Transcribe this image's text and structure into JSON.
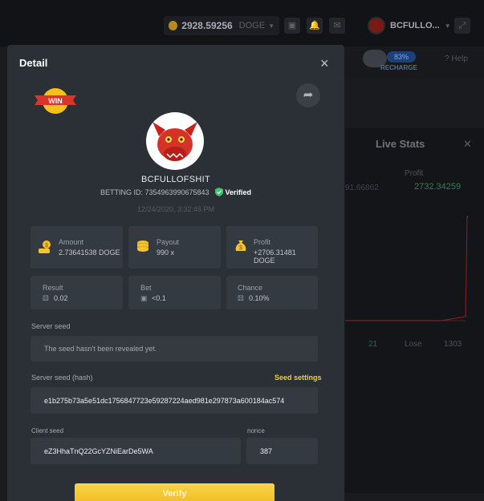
{
  "topbar": {
    "balance": "2928.59256",
    "currency": "DOGE",
    "username": "BCFULLO...",
    "recharge": "RECHARGE",
    "percent": "83%",
    "help": "Help"
  },
  "livestats": {
    "title": "Live Stats",
    "profit_label": "Profit",
    "profit_value": "2732.34259",
    "partial_value": "91.66862",
    "lose_label": "Lose",
    "count_a": "21",
    "count_b": "1303"
  },
  "modal": {
    "title": "Detail",
    "close": "×",
    "win_label": "WIN",
    "username": "BCFULLOFSHIT",
    "betting_id": "BETTING ID: 7354963990675843",
    "verified": "Verified",
    "date": "12/24/2020, 3:32:46 PM",
    "stats": [
      {
        "label": "Amount",
        "value": "2.73641538 DOGE"
      },
      {
        "label": "Payout",
        "value": "990 x"
      },
      {
        "label": "Profit",
        "value": "+2706.31481 DOGE"
      },
      {
        "label": "Result",
        "value": "0.02"
      },
      {
        "label": "Bet",
        "value": "<0.1"
      },
      {
        "label": "Chance",
        "value": "0.10%"
      }
    ],
    "server_seed_label": "Server seed",
    "server_seed_value": "The seed hasn't been revealed yet.",
    "server_hash_label": "Server seed (hash)",
    "seed_settings": "Seed settings",
    "server_hash_value": "e1b275b73a5e51dc1756847723e59287224aed981e297873a600184ac574",
    "client_seed_label": "Client seed",
    "client_seed_value": "eZ3HhaTnQ22GcYZNiEarDe5WA",
    "nonce_label": "nonce",
    "nonce_value": "387",
    "verify_label": "Verify"
  },
  "colors": {
    "accent": "#f6cd2d",
    "verified": "#3bc66f",
    "modal_bg": "#2b3036",
    "card_bg": "#343a42"
  }
}
